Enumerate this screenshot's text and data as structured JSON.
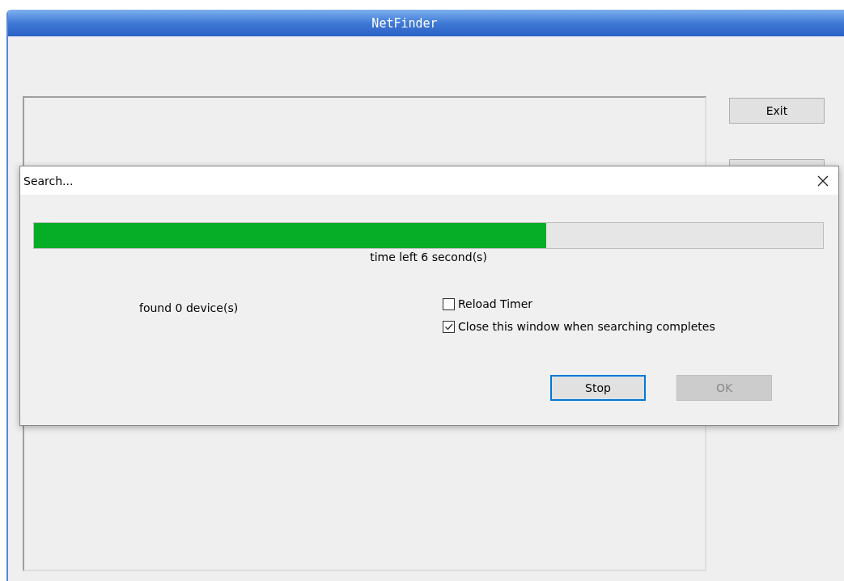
{
  "window": {
    "title": "NetFinder"
  },
  "exit_button": {
    "label": "Exit"
  },
  "dialog": {
    "title": "Search...",
    "progress": {
      "level": 0.649
    },
    "time_left": "time left 6 second(s)",
    "found": "found 0 device(s)",
    "options": [
      {
        "label": "Reload Timer",
        "checked": false
      },
      {
        "label": "Close this window when searching completes",
        "checked": true
      }
    ],
    "buttons": [
      {
        "label": "Stop",
        "disabled": false,
        "focused": true
      },
      {
        "label": "OK",
        "disabled": true,
        "focused": false
      }
    ]
  }
}
